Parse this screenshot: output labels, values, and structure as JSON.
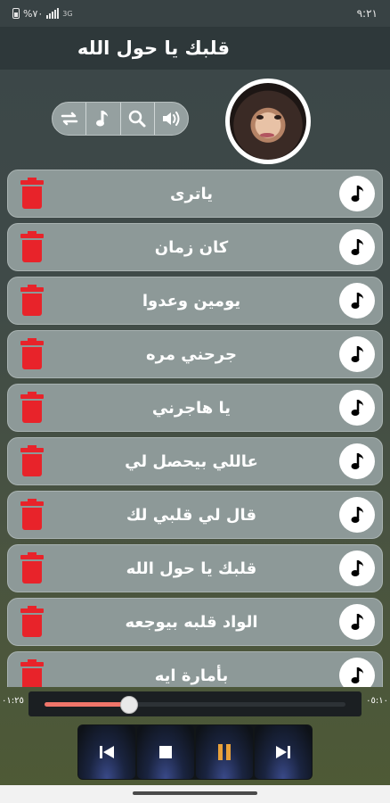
{
  "status_bar": {
    "time": "٩:٢١",
    "battery": "%٧٠",
    "network": "3G"
  },
  "header": {
    "title": "قلبك يا حول الله"
  },
  "toolbar": {
    "icons": [
      "repeat-icon",
      "music-icon",
      "search-icon",
      "volume-icon"
    ]
  },
  "songs": [
    {
      "title": "ياترى"
    },
    {
      "title": "كان زمان"
    },
    {
      "title": "يومين وعدوا"
    },
    {
      "title": "جرحني مره"
    },
    {
      "title": "يا هاجرني"
    },
    {
      "title": "عاللي بيحصل لي"
    },
    {
      "title": "قال لي قلبي لك"
    },
    {
      "title": "قلبك يا حول الله"
    },
    {
      "title": "الواد قلبه بيوجعه"
    },
    {
      "title": "بأمارة ايه"
    }
  ],
  "player": {
    "elapsed": "٠١:٢٥",
    "duration": "٠٥:١٠",
    "progress": 0.28,
    "accent": "#f0756a"
  },
  "controls": {
    "icons": [
      "previous-icon",
      "stop-icon",
      "pause-icon",
      "next-icon"
    ],
    "pause_color": "#e9a13a"
  }
}
